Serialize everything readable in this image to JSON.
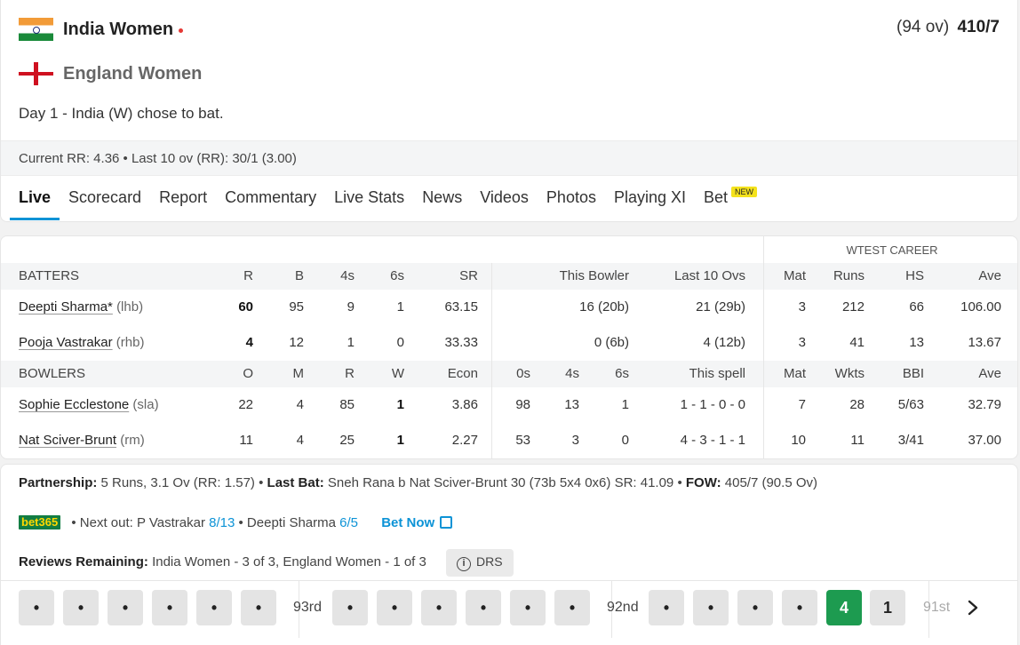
{
  "header": {
    "team1": "India Women",
    "team2": "England Women",
    "score_overs": "(94 ov)",
    "score_runs": "410/7",
    "status": "Day 1 - India (W) chose to bat.",
    "run_rate": "Current RR: 4.36 • Last 10 ov (RR): 30/1 (3.00)"
  },
  "tabs": [
    {
      "label": "Live"
    },
    {
      "label": "Scorecard"
    },
    {
      "label": "Report"
    },
    {
      "label": "Commentary"
    },
    {
      "label": "Live Stats"
    },
    {
      "label": "News"
    },
    {
      "label": "Videos"
    },
    {
      "label": "Photos"
    },
    {
      "label": "Playing XI"
    },
    {
      "label": "Bet",
      "badge": "NEW"
    }
  ],
  "table": {
    "career_label": "WTEST CAREER",
    "batters_header": [
      "BATTERS",
      "R",
      "B",
      "4s",
      "6s",
      "SR",
      "This Bowler",
      "Last 10 Ovs",
      "Mat",
      "Runs",
      "HS",
      "Ave"
    ],
    "batters": [
      {
        "name": "Deepti Sharma*",
        "hand": "(lhb)",
        "r": "60",
        "b": "95",
        "fours": "9",
        "sixes": "1",
        "sr": "63.15",
        "this_bowler": "16 (20b)",
        "last10": "21 (29b)",
        "mat": "3",
        "runs": "212",
        "hs": "66",
        "ave": "106.00"
      },
      {
        "name": "Pooja Vastrakar",
        "hand": "(rhb)",
        "r": "4",
        "b": "12",
        "fours": "1",
        "sixes": "0",
        "sr": "33.33",
        "this_bowler": "0 (6b)",
        "last10": "4 (12b)",
        "mat": "3",
        "runs": "41",
        "hs": "13",
        "ave": "13.67"
      }
    ],
    "bowlers_header": [
      "BOWLERS",
      "O",
      "M",
      "R",
      "W",
      "Econ",
      "0s",
      "4s",
      "6s",
      "This spell",
      "Mat",
      "Wkts",
      "BBI",
      "Ave"
    ],
    "bowlers": [
      {
        "name": "Sophie Ecclestone",
        "style": "(sla)",
        "o": "22",
        "m": "4",
        "r": "85",
        "w": "1",
        "econ": "3.86",
        "dots": "98",
        "fours": "13",
        "sixes": "1",
        "spell": "1 - 1 - 0 - 0",
        "mat": "7",
        "wkts": "28",
        "bbi": "5/63",
        "ave": "32.79"
      },
      {
        "name": "Nat Sciver-Brunt",
        "style": "(rm)",
        "o": "11",
        "m": "4",
        "r": "25",
        "w": "1",
        "econ": "2.27",
        "dots": "53",
        "fours": "3",
        "sixes": "0",
        "spell": "4 - 3 - 1 - 1",
        "mat": "10",
        "wkts": "11",
        "bbi": "3/41",
        "ave": "37.00"
      }
    ]
  },
  "info": {
    "partnership_label": "Partnership:",
    "partnership_value": "5 Runs, 3.1 Ov (RR: 1.57) •",
    "last_bat_label": "Last Bat:",
    "last_bat_value": "Sneh Rana b Nat Sciver-Brunt 30 (73b 5x4 0x6) SR: 41.09 •",
    "fow_label": "FOW:",
    "fow_value": "405/7 (90.5 Ov)",
    "bet_logo": "bet365",
    "next_out_prefix": "• Next out: P Vastrakar",
    "next_out_odds1": "8/13",
    "next_out_mid": "• Deepti Sharma",
    "next_out_odds2": "6/5",
    "bet_now": "Bet Now",
    "reviews_label": "Reviews Remaining:",
    "reviews_value": "India Women - 3 of 3, England Women - 1 of 3",
    "drs_label": "DRS",
    "info_glyph": "i"
  },
  "overs": {
    "over94_balls": [
      "•",
      "•",
      "•",
      "•",
      "•",
      "•"
    ],
    "label93": "93rd",
    "over93_balls": [
      "•",
      "•",
      "•",
      "•",
      "•",
      "•"
    ],
    "label92": "92nd",
    "over92_balls": [
      "•",
      "•",
      "•",
      "•",
      "4",
      "1"
    ],
    "label91": "91st"
  }
}
